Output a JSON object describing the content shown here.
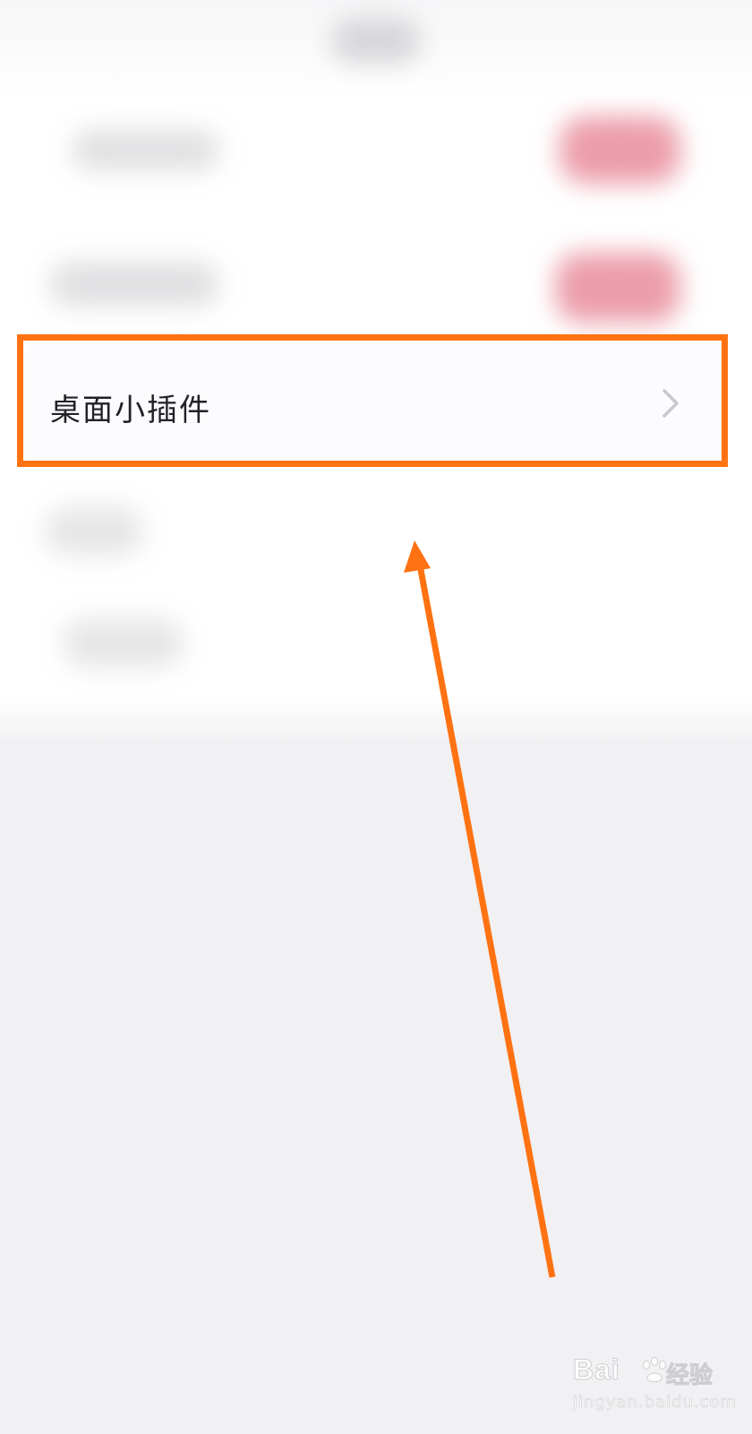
{
  "settings_row": {
    "label": "桌面小插件",
    "trailing_icon": "chevron-right-icon"
  },
  "annotation": {
    "highlight_color": "#ff7212",
    "arrow_color": "#ff7212"
  },
  "watermark": {
    "brand": "Bai",
    "brand_suffix": "du",
    "cn_label": "经验",
    "url": "jingyan.baidu.com"
  },
  "colors": {
    "background": "#f1f0f2",
    "card": "#ffffff",
    "toggle_blur": "#ec9dab",
    "text": "#222226"
  }
}
